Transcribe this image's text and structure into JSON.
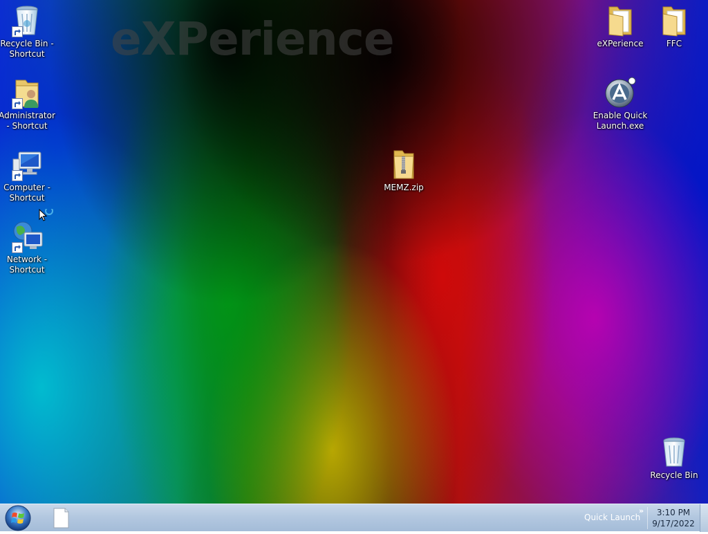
{
  "desktop": {
    "watermark": "eXPerience",
    "icons": [
      {
        "id": "recycle-bin-shortcut",
        "label": "Recycle Bin - Shortcut",
        "icon": "recycle-bin-icon",
        "shortcut": true
      },
      {
        "id": "administrator-shortcut",
        "label": "Administrator - Shortcut",
        "icon": "user-folder-icon",
        "shortcut": true
      },
      {
        "id": "computer-shortcut",
        "label": "Computer - Shortcut",
        "icon": "computer-icon",
        "shortcut": true
      },
      {
        "id": "network-shortcut",
        "label": "Network - Shortcut",
        "icon": "network-icon",
        "shortcut": true
      },
      {
        "id": "memz-zip",
        "label": "MEMZ.zip",
        "icon": "zip-folder-icon",
        "shortcut": false
      },
      {
        "id": "experience-folder",
        "label": "eXPerience",
        "icon": "folder-icon",
        "shortcut": false
      },
      {
        "id": "ffc-folder",
        "label": "FFC",
        "icon": "folder-icon",
        "shortcut": false
      },
      {
        "id": "enable-quick-launch",
        "label": "Enable Quick Launch.exe",
        "icon": "aero-app-icon",
        "shortcut": false
      },
      {
        "id": "recycle-bin",
        "label": "Recycle Bin",
        "icon": "recycle-bin-icon",
        "shortcut": false
      }
    ]
  },
  "taskbar": {
    "start_button": "windows-orb-icon",
    "item_icon": "blank-document-icon",
    "quick_launch_label": "Quick Launch",
    "chevron": "»",
    "clock": {
      "time": "3:10 PM",
      "date": "9/17/2022"
    }
  },
  "colors": {
    "taskbar": "#b3c8e0",
    "folder": "#f2d98a",
    "label_text": "#ffffff"
  }
}
